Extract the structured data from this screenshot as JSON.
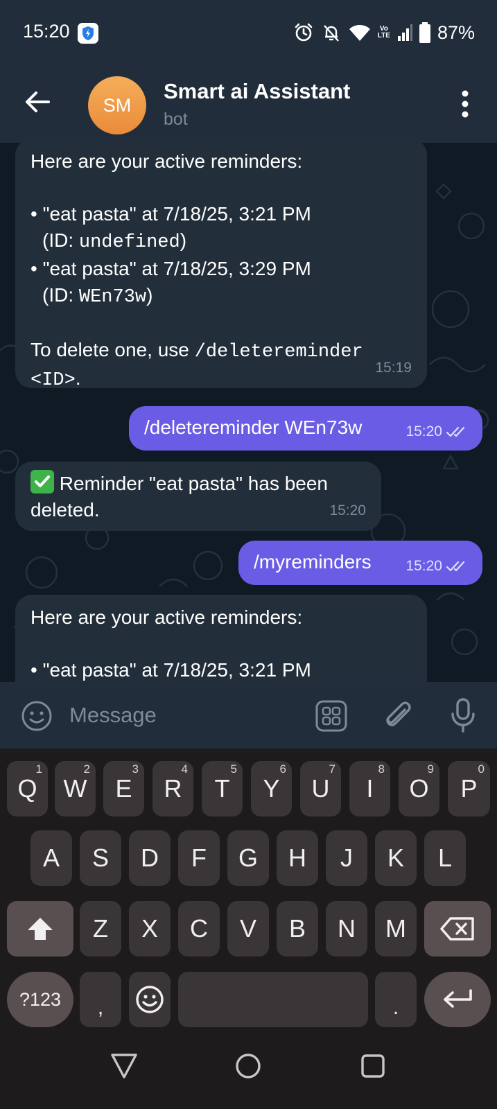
{
  "status_bar": {
    "time": "15:20",
    "battery": "87%",
    "network_label": "LTE"
  },
  "header": {
    "avatar_initials": "SM",
    "title": "Smart ai Assistant",
    "subtitle": "bot"
  },
  "messages": [
    {
      "direction": "incoming",
      "lines": [
        "Here are your active reminders:",
        "",
        "• \"eat pasta\" at 7/18/25, 3:21 PM",
        "(ID: ",
        "undefined",
        ")",
        "• \"eat pasta\" at 7/18/25, 3:29 PM",
        "(ID: ",
        "WEn73w",
        ")",
        "",
        "To delete one, use ",
        "/deletereminder",
        "<ID>",
        "."
      ],
      "time": "15:19"
    },
    {
      "direction": "outgoing",
      "text": "/deletereminder WEn73w",
      "time": "15:20"
    },
    {
      "direction": "incoming",
      "emoji": "✅",
      "text_line1": " Reminder \"eat pasta\" has been",
      "text_line2": "deleted.",
      "time": "15:20"
    },
    {
      "direction": "outgoing",
      "text": "/myreminders",
      "time": "15:20"
    },
    {
      "direction": "incoming",
      "lines": [
        "Here are your active reminders:",
        "",
        "• \"eat pasta\" at 7/18/25, 3:21 PM"
      ]
    }
  ],
  "input": {
    "placeholder": "Message"
  },
  "keyboard": {
    "row1": [
      "Q",
      "W",
      "E",
      "R",
      "T",
      "Y",
      "U",
      "I",
      "O",
      "P"
    ],
    "row1_hints": [
      "1",
      "2",
      "3",
      "4",
      "5",
      "6",
      "7",
      "8",
      "9",
      "0"
    ],
    "row2": [
      "A",
      "S",
      "D",
      "F",
      "G",
      "H",
      "J",
      "K",
      "L"
    ],
    "row3": [
      "Z",
      "X",
      "C",
      "V",
      "B",
      "N",
      "M"
    ],
    "symbols_key": "?123",
    "comma_key": ",",
    "period_key": "."
  },
  "colors": {
    "header_bg": "#212d3b",
    "chat_bg": "#0f1a25",
    "incoming_bubble": "#222e3a",
    "outgoing_bubble": "#6b5ce6",
    "keyboard_bg": "#1e1b1c"
  }
}
